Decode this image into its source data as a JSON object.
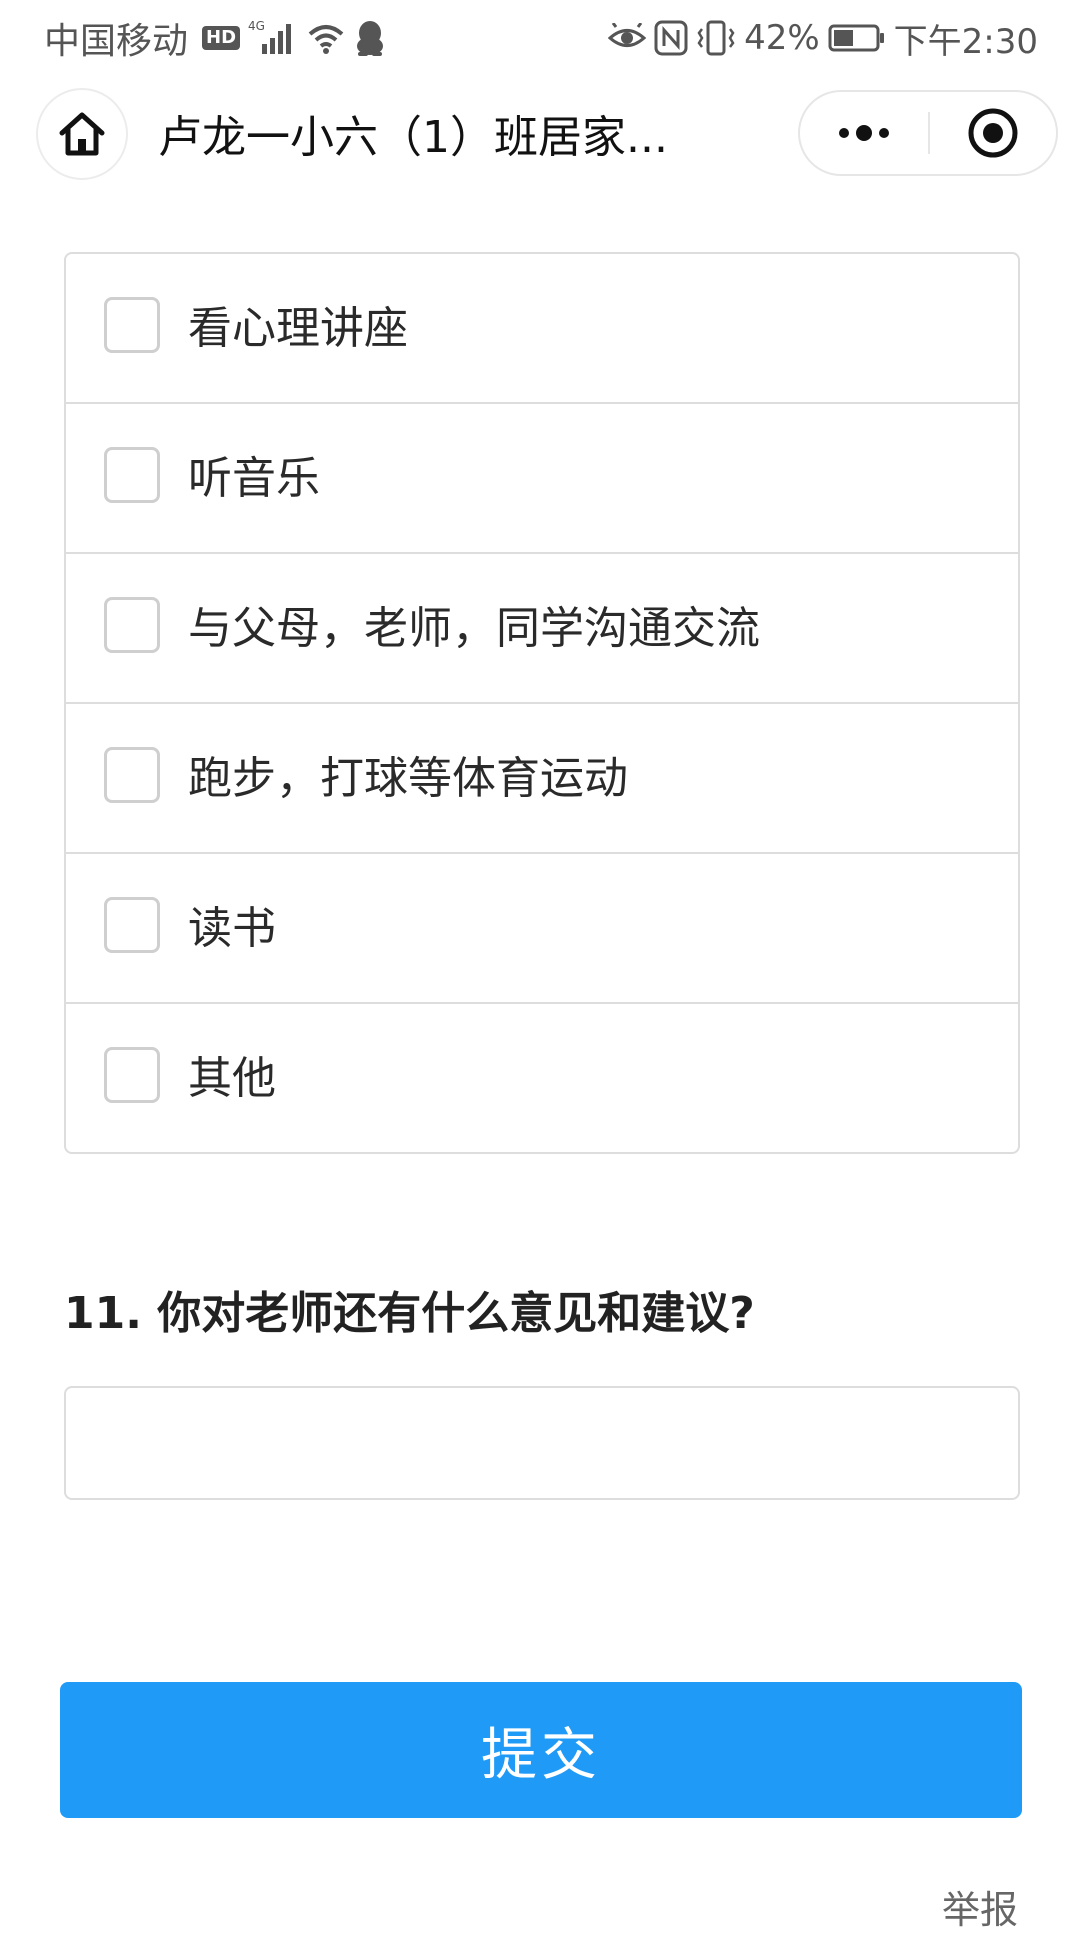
{
  "status_bar": {
    "carrier": "中国移动",
    "hd_badge": "HD",
    "network": "4G",
    "battery": "42%",
    "time": "下午2:30",
    "icons": [
      "hd-icon",
      "signal-icon",
      "wifi-icon",
      "qq-icon",
      "eye-icon",
      "nfc-icon",
      "vibrate-icon",
      "battery-icon"
    ]
  },
  "header": {
    "title": "卢龙一小六（1）班居家...",
    "home_icon": "home-icon",
    "more_icon": "more-dots-icon",
    "close_icon": "target-close-icon"
  },
  "options": [
    {
      "label": "看心理讲座",
      "checked": false
    },
    {
      "label": "听音乐",
      "checked": false
    },
    {
      "label": "与父母，老师，同学沟通交流",
      "checked": false
    },
    {
      "label": "跑步，打球等体育运动",
      "checked": false
    },
    {
      "label": "读书",
      "checked": false
    },
    {
      "label": "其他",
      "checked": false
    }
  ],
  "question11": {
    "title": "11. 你对老师还有什么意见和建议?",
    "value": ""
  },
  "submit": {
    "label": "提交",
    "color": "#1f9bf7"
  },
  "report": {
    "label": "举报"
  }
}
